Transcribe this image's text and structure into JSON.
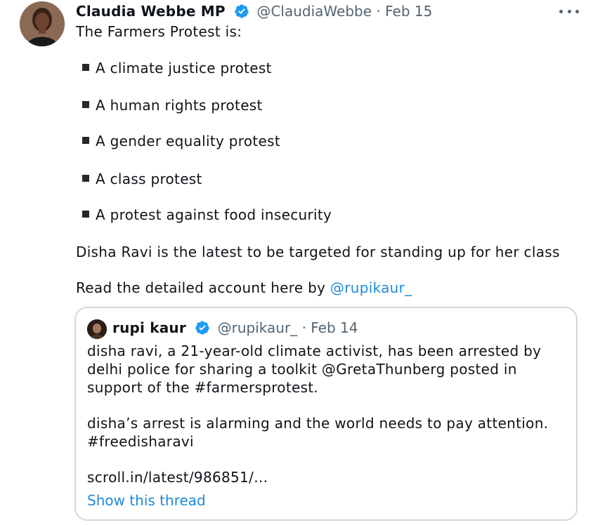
{
  "tweet": {
    "author_name": "Claudia Webbe MP",
    "handle": "@ClaudiaWebbe",
    "separator": "·",
    "date": "Feb 15",
    "intro": "The Farmers Protest is:",
    "bullets": [
      "A climate justice protest",
      "A human rights protest",
      "A gender equality protest",
      "A class protest",
      "A protest against food insecurity"
    ],
    "paragraph": "Disha Ravi is the latest to be targeted for standing up for her class",
    "read_prefix": "Read the detailed account here by ",
    "read_link": "@rupikaur_"
  },
  "quote": {
    "author_name": "rupi kaur",
    "handle": "@rupikaur_",
    "separator": "·",
    "date": "Feb 14",
    "lines": [
      "disha ravi, a 21-year-old climate activist, has been arrested by",
      "delhi police for sharing a toolkit @GretaThunberg  posted in",
      "support of the #farmersprotest.",
      "disha’s arrest is alarming and the world needs to pay attention.",
      "#freedisharavi",
      "scroll.in/latest/986851/…"
    ],
    "show_thread": "Show this thread"
  },
  "colors": {
    "text": "#0f1419",
    "secondary": "#536471",
    "link": "#1d8ad8",
    "verified": "#1d9bf0",
    "border": "#cfd9de"
  },
  "icons": {
    "verified": "verified-badge-icon",
    "more": "more-dots-icon"
  }
}
